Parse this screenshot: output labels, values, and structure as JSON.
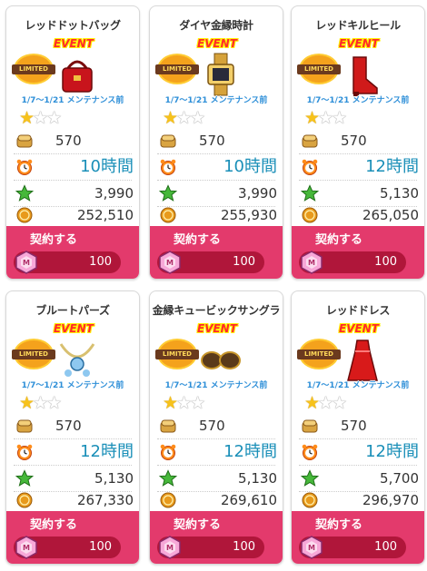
{
  "labels": {
    "limited": "LIMITED",
    "event": "EVENT",
    "contract_button": "契約する"
  },
  "colors": {
    "contract_bg": "#e33a6c",
    "cost_bar": "#b0163a",
    "time_text": "#1a8fb8",
    "maintenance_text": "#2e8fd8",
    "star_filled": "#f7c21b"
  },
  "icons": {
    "bread": "bread-icon",
    "clock": "alarm-clock-icon",
    "star": "green-star-icon",
    "coin": "coin-icon",
    "gem": "pink-gem-icon"
  },
  "items": [
    {
      "name": "レッドドットバッグ",
      "maintenance": "1/7～1/21 メンテナンス前",
      "rating": 1,
      "stars_max": 3,
      "bread": "570",
      "time": "10時間",
      "exp": "3,990",
      "coins": "252,510",
      "cost": "100",
      "art": "red-bag-image"
    },
    {
      "name": "ダイヤ金縁時計",
      "maintenance": "1/7～1/21 メンテナンス前",
      "rating": 1,
      "stars_max": 3,
      "bread": "570",
      "time": "10時間",
      "exp": "3,990",
      "coins": "255,930",
      "cost": "100",
      "art": "gold-watch-image"
    },
    {
      "name": "レッドキルヒール",
      "maintenance": "1/7～1/21 メンテナンス前",
      "rating": 1,
      "stars_max": 3,
      "bread": "570",
      "time": "12時間",
      "exp": "5,130",
      "coins": "265,050",
      "cost": "100",
      "art": "red-heel-image"
    },
    {
      "name": "ブルートパーズ",
      "maintenance": "1/7～1/21 メンテナンス前",
      "rating": 1,
      "stars_max": 3,
      "bread": "570",
      "time": "12時間",
      "exp": "5,130",
      "coins": "267,330",
      "cost": "100",
      "art": "topaz-jewelry-image"
    },
    {
      "name": "金縁キュービックサングラ",
      "maintenance": "1/7～1/21 メンテナンス前",
      "rating": 1,
      "stars_max": 3,
      "bread": "570",
      "time": "12時間",
      "exp": "5,130",
      "coins": "269,610",
      "cost": "100",
      "art": "sunglasses-image"
    },
    {
      "name": "レッドドレス",
      "maintenance": "1/7～1/21 メンテナンス前",
      "rating": 1,
      "stars_max": 3,
      "bread": "570",
      "time": "12時間",
      "exp": "5,700",
      "coins": "296,970",
      "cost": "100",
      "art": "red-dress-image"
    }
  ]
}
